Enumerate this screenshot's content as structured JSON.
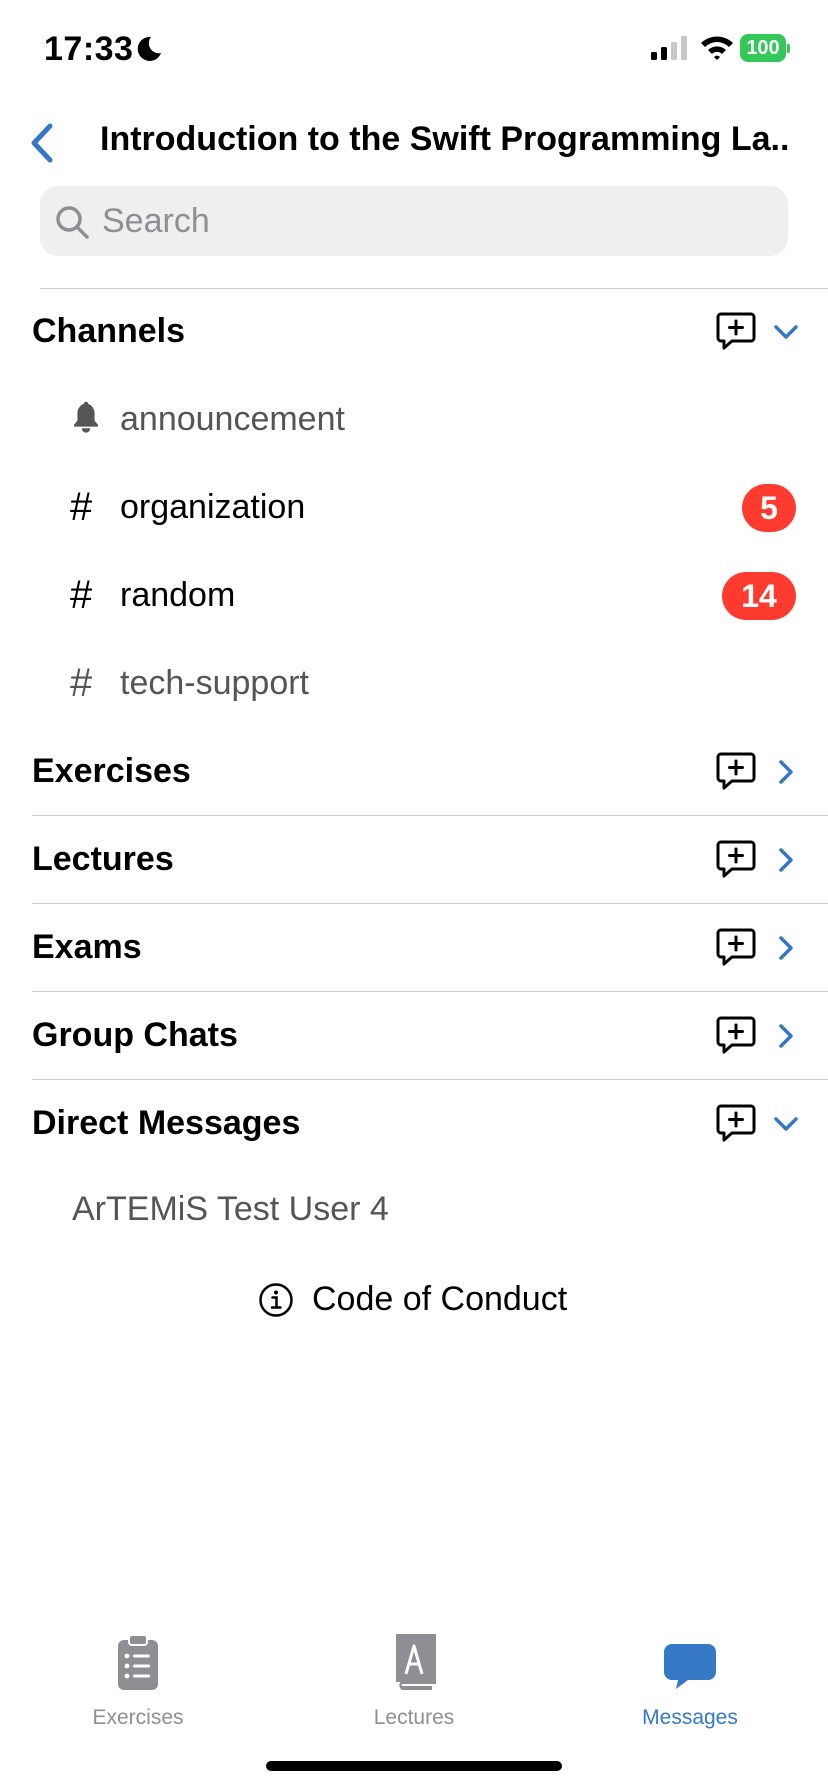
{
  "status_bar": {
    "time": "17:33",
    "battery": "100"
  },
  "nav": {
    "title": "Introduction to the Swift Programming La..."
  },
  "search": {
    "placeholder": "Search",
    "value": ""
  },
  "sections": {
    "channels": {
      "title": "Channels",
      "expanded": true
    },
    "exercises": {
      "title": "Exercises",
      "expanded": false
    },
    "lectures": {
      "title": "Lectures",
      "expanded": false
    },
    "exams": {
      "title": "Exams",
      "expanded": false
    },
    "group_chats": {
      "title": "Group Chats",
      "expanded": false
    },
    "direct_messages": {
      "title": "Direct Messages",
      "expanded": true
    }
  },
  "channels": [
    {
      "icon": "bell-icon",
      "name": "announcement",
      "unread": null
    },
    {
      "icon": "hash-icon",
      "name": "organization",
      "unread": "5"
    },
    {
      "icon": "hash-icon",
      "name": "random",
      "unread": "14"
    },
    {
      "icon": "hash-icon",
      "name": "tech-support",
      "unread": null
    }
  ],
  "direct_messages": [
    {
      "name": "ArTEMiS Test User 4"
    }
  ],
  "code_of_conduct": {
    "label": "Code of Conduct",
    "icon": "info-circle-icon"
  },
  "tab_bar": [
    {
      "label": "Exercises",
      "icon": "clipboard-list-icon",
      "active": false
    },
    {
      "label": "Lectures",
      "icon": "book-icon",
      "active": false
    },
    {
      "label": "Messages",
      "icon": "message-bubble-icon",
      "active": true
    }
  ],
  "colors": {
    "accent": "#3478c6",
    "badge": "#ff3b30",
    "battery": "#34c759"
  }
}
